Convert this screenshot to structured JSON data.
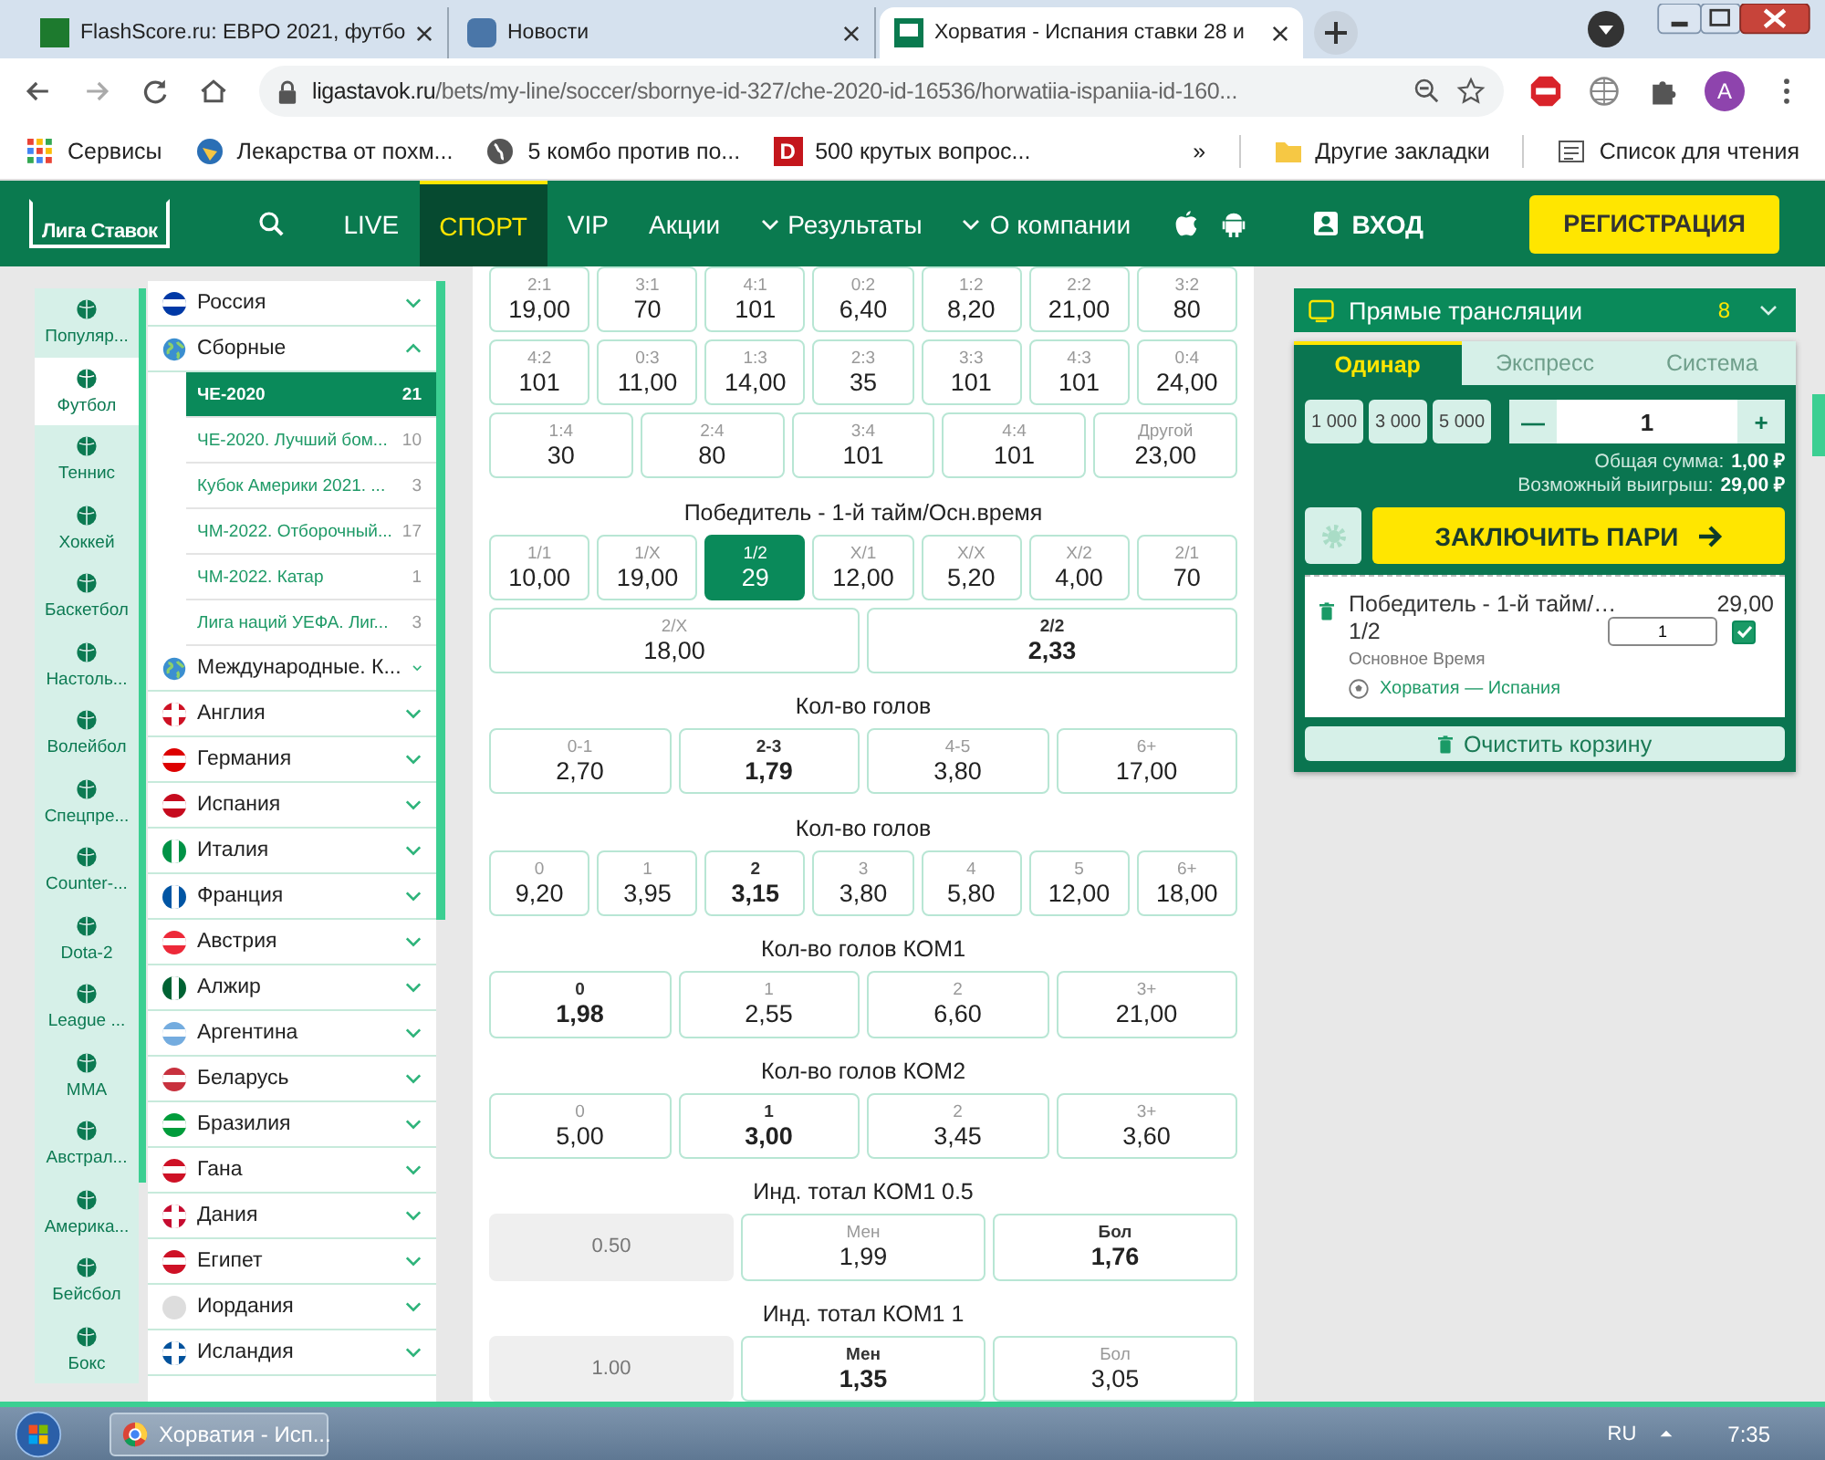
{
  "browser": {
    "tabs": [
      {
        "title": "FlashScore.ru: ЕВРО 2021, футбо",
        "kind": "score",
        "selected": false
      },
      {
        "title": "Новости",
        "kind": "vk",
        "selected": false
      },
      {
        "title": "Хорватия - Испания ставки 28 и",
        "kind": "liga",
        "selected": true
      }
    ],
    "address": {
      "host": "ligastavok.ru",
      "path": "/bets/my-line/soccer/sbornye-id-327/che-2020-id-16536/horwatiia-ispaniia-id-160..."
    },
    "profile": "A",
    "bookmarks": [
      {
        "kind": "apps",
        "label": "Сервисы"
      },
      {
        "kind": "site",
        "label": "Лекарства от похм..."
      },
      {
        "kind": "globe",
        "label": "5 комбо против по..."
      },
      {
        "kind": "letter",
        "letter": "D",
        "label": "500 крутых вопрос..."
      }
    ],
    "bookmarks_more": "»",
    "other_bookmarks": "Другие закладки",
    "reading_list": "Список для чтения"
  },
  "site": {
    "logo": "Лига Ставок",
    "nav": [
      {
        "label": "LIVE",
        "selected": false,
        "dropdown": false
      },
      {
        "label": "СПОРТ",
        "selected": true,
        "dropdown": false
      },
      {
        "label": "VIP",
        "selected": false,
        "dropdown": false
      },
      {
        "label": "Акции",
        "selected": false,
        "dropdown": false
      },
      {
        "label": "Результаты",
        "selected": false,
        "dropdown": true
      },
      {
        "label": "О компании",
        "selected": false,
        "dropdown": true
      }
    ],
    "login": "ВХОД",
    "register": "РЕГИСТРАЦИЯ"
  },
  "sports": [
    {
      "label": "Популяр...",
      "selected": false
    },
    {
      "label": "Футбол",
      "selected": true
    },
    {
      "label": "Теннис",
      "selected": false
    },
    {
      "label": "Хоккей",
      "selected": false
    },
    {
      "label": "Баскетбол",
      "selected": false
    },
    {
      "label": "Настоль...",
      "selected": false
    },
    {
      "label": "Волейбол",
      "selected": false
    },
    {
      "label": "Спецпре...",
      "selected": false
    },
    {
      "label": "Counter-...",
      "selected": false
    },
    {
      "label": "Dota-2",
      "selected": false
    },
    {
      "label": "League ...",
      "selected": false
    },
    {
      "label": "MMA",
      "selected": false
    },
    {
      "label": "Австрал...",
      "selected": false
    },
    {
      "label": "Америка...",
      "selected": false
    },
    {
      "label": "Бейсбол",
      "selected": false
    },
    {
      "label": "Бокс",
      "selected": false
    }
  ],
  "countries": [
    {
      "label": "Россия",
      "kind": "hflag",
      "color": "#0039a6",
      "expanded": false
    },
    {
      "label": "Сборные",
      "kind": "globe",
      "expanded": true,
      "children": [
        {
          "label": "ЧЕ-2020",
          "count": "21",
          "selected": true
        },
        {
          "label": "ЧЕ-2020. Лучший бом...",
          "count": "10",
          "selected": false
        },
        {
          "label": "Кубок Америки 2021. ...",
          "count": "3",
          "selected": false
        },
        {
          "label": "ЧМ-2022. Отборочный...",
          "count": "17",
          "selected": false
        },
        {
          "label": "ЧМ-2022. Катар",
          "count": "1",
          "selected": false
        },
        {
          "label": "Лига наций УЕФА. Лиг...",
          "count": "3",
          "selected": false
        }
      ]
    },
    {
      "label": "Международные. К...",
      "kind": "globe",
      "expanded": false
    },
    {
      "label": "Англия",
      "kind": "cross",
      "color": "#ce1124",
      "expanded": false
    },
    {
      "label": "Германия",
      "kind": "hflag",
      "color": "#dd0000",
      "expanded": false
    },
    {
      "label": "Испания",
      "kind": "hflag",
      "color": "#c60b1e",
      "expanded": false
    },
    {
      "label": "Италия",
      "kind": "vflag",
      "color": "#009246",
      "expanded": false
    },
    {
      "label": "Франция",
      "kind": "vflag",
      "color": "#0055a4",
      "expanded": false
    },
    {
      "label": "Австрия",
      "kind": "hflag",
      "color": "#ed2939",
      "expanded": false
    },
    {
      "label": "Алжир",
      "kind": "vflag",
      "color": "#006233",
      "expanded": false
    },
    {
      "label": "Аргентина",
      "kind": "hflag",
      "color": "#74acdf",
      "expanded": false
    },
    {
      "label": "Беларусь",
      "kind": "hflag",
      "color": "#c8313e",
      "expanded": false
    },
    {
      "label": "Бразилия",
      "kind": "hflag",
      "color": "#009c3b",
      "expanded": false
    },
    {
      "label": "Гана",
      "kind": "hflag",
      "color": "#ce1126",
      "expanded": false
    },
    {
      "label": "Дания",
      "kind": "cross",
      "color": "#c60c30",
      "expanded": false
    },
    {
      "label": "Египет",
      "kind": "hflag",
      "color": "#ce1126",
      "expanded": false
    },
    {
      "label": "Иордания",
      "kind": "blank",
      "color": "#dddddd",
      "expanded": false
    },
    {
      "label": "Исландия",
      "kind": "cross",
      "color": "#02529c",
      "expanded": false
    }
  ],
  "markets": [
    {
      "lines": [
        {
          "outcomes": [
            {
              "kind": "odds",
              "label": "2:1",
              "odds": "19,00",
              "selected": false,
              "highlighted": false
            },
            {
              "kind": "odds",
              "label": "3:1",
              "odds": "70",
              "selected": false,
              "highlighted": false
            },
            {
              "kind": "odds",
              "label": "4:1",
              "odds": "101",
              "selected": false,
              "highlighted": false
            },
            {
              "kind": "odds",
              "label": "0:2",
              "odds": "6,40",
              "selected": false,
              "highlighted": false
            },
            {
              "kind": "odds",
              "label": "1:2",
              "odds": "8,20",
              "selected": false,
              "highlighted": false
            },
            {
              "kind": "odds",
              "label": "2:2",
              "odds": "21,00",
              "selected": false,
              "highlighted": false
            },
            {
              "kind": "odds",
              "label": "3:2",
              "odds": "80",
              "selected": false,
              "highlighted": false
            }
          ]
        },
        {
          "outcomes": [
            {
              "kind": "odds",
              "label": "4:2",
              "odds": "101",
              "selected": false,
              "highlighted": false
            },
            {
              "kind": "odds",
              "label": "0:3",
              "odds": "11,00",
              "selected": false,
              "highlighted": false
            },
            {
              "kind": "odds",
              "label": "1:3",
              "odds": "14,00",
              "selected": false,
              "highlighted": false
            },
            {
              "kind": "odds",
              "label": "2:3",
              "odds": "35",
              "selected": false,
              "highlighted": false
            },
            {
              "kind": "odds",
              "label": "3:3",
              "odds": "101",
              "selected": false,
              "highlighted": false
            },
            {
              "kind": "odds",
              "label": "4:3",
              "odds": "101",
              "selected": false,
              "highlighted": false
            },
            {
              "kind": "odds",
              "label": "0:4",
              "odds": "24,00",
              "selected": false,
              "highlighted": false
            }
          ]
        },
        {
          "outcomes": [
            {
              "kind": "odds",
              "label": "1:4",
              "odds": "30",
              "selected": false,
              "highlighted": false
            },
            {
              "kind": "odds",
              "label": "2:4",
              "odds": "80",
              "selected": false,
              "highlighted": false
            },
            {
              "kind": "odds",
              "label": "3:4",
              "odds": "101",
              "selected": false,
              "highlighted": false
            },
            {
              "kind": "odds",
              "label": "4:4",
              "odds": "101",
              "selected": false,
              "highlighted": false
            },
            {
              "kind": "odds",
              "label": "Другой",
              "odds": "23,00",
              "selected": false,
              "highlighted": false
            }
          ]
        }
      ]
    },
    {
      "title": "Победитель - 1-й тайм/Осн.время",
      "lines": [
        {
          "outcomes": [
            {
              "kind": "odds",
              "label": "1/1",
              "odds": "10,00",
              "selected": false,
              "highlighted": false
            },
            {
              "kind": "odds",
              "label": "1/X",
              "odds": "19,00",
              "selected": false,
              "highlighted": false
            },
            {
              "kind": "odds",
              "label": "1/2",
              "odds": "29",
              "selected": true,
              "highlighted": false
            },
            {
              "kind": "odds",
              "label": "X/1",
              "odds": "12,00",
              "selected": false,
              "highlighted": false
            },
            {
              "kind": "odds",
              "label": "X/X",
              "odds": "5,20",
              "selected": false,
              "highlighted": false
            },
            {
              "kind": "odds",
              "label": "X/2",
              "odds": "4,00",
              "selected": false,
              "highlighted": false
            },
            {
              "kind": "odds",
              "label": "2/1",
              "odds": "70",
              "selected": false,
              "highlighted": false
            }
          ]
        },
        {
          "outcomes": [
            {
              "kind": "odds",
              "label": "2/X",
              "odds": "18,00",
              "selected": false,
              "highlighted": false
            },
            {
              "kind": "odds",
              "label": "2/2",
              "odds": "2,33",
              "selected": false,
              "highlighted": true
            }
          ]
        }
      ]
    },
    {
      "title": "Кол-во голов",
      "lines": [
        {
          "outcomes": [
            {
              "kind": "odds",
              "label": "0-1",
              "odds": "2,70",
              "selected": false,
              "highlighted": false
            },
            {
              "kind": "odds",
              "label": "2-3",
              "odds": "1,79",
              "selected": false,
              "highlighted": true
            },
            {
              "kind": "odds",
              "label": "4-5",
              "odds": "3,80",
              "selected": false,
              "highlighted": false
            },
            {
              "kind": "odds",
              "label": "6+",
              "odds": "17,00",
              "selected": false,
              "highlighted": false
            }
          ]
        }
      ]
    },
    {
      "title": "Кол-во голов",
      "lines": [
        {
          "outcomes": [
            {
              "kind": "odds",
              "label": "0",
              "odds": "9,20",
              "selected": false,
              "highlighted": false
            },
            {
              "kind": "odds",
              "label": "1",
              "odds": "3,95",
              "selected": false,
              "highlighted": false
            },
            {
              "kind": "odds",
              "label": "2",
              "odds": "3,15",
              "selected": false,
              "highlighted": true
            },
            {
              "kind": "odds",
              "label": "3",
              "odds": "3,80",
              "selected": false,
              "highlighted": false
            },
            {
              "kind": "odds",
              "label": "4",
              "odds": "5,80",
              "selected": false,
              "highlighted": false
            },
            {
              "kind": "odds",
              "label": "5",
              "odds": "12,00",
              "selected": false,
              "highlighted": false
            },
            {
              "kind": "odds",
              "label": "6+",
              "odds": "18,00",
              "selected": false,
              "highlighted": false
            }
          ]
        }
      ]
    },
    {
      "title": "Кол-во голов КОМ1",
      "lines": [
        {
          "outcomes": [
            {
              "kind": "odds",
              "label": "0",
              "odds": "1,98",
              "selected": false,
              "highlighted": true
            },
            {
              "kind": "odds",
              "label": "1",
              "odds": "2,55",
              "selected": false,
              "highlighted": false
            },
            {
              "kind": "odds",
              "label": "2",
              "odds": "6,60",
              "selected": false,
              "highlighted": false
            },
            {
              "kind": "odds",
              "label": "3+",
              "odds": "21,00",
              "selected": false,
              "highlighted": false
            }
          ]
        }
      ]
    },
    {
      "title": "Кол-во голов КОМ2",
      "lines": [
        {
          "outcomes": [
            {
              "kind": "odds",
              "label": "0",
              "odds": "5,00",
              "selected": false,
              "highlighted": false
            },
            {
              "kind": "odds",
              "label": "1",
              "odds": "3,00",
              "selected": false,
              "highlighted": true
            },
            {
              "kind": "odds",
              "label": "2",
              "odds": "3,45",
              "selected": false,
              "highlighted": false
            },
            {
              "kind": "odds",
              "label": "3+",
              "odds": "3,60",
              "selected": false,
              "highlighted": false
            }
          ]
        }
      ]
    },
    {
      "title": "Инд. тотал КОМ1 0.5",
      "lines": [
        {
          "outcomes": [
            {
              "kind": "line",
              "label": "0.50"
            },
            {
              "kind": "odds",
              "label": "Мен",
              "odds": "1,99",
              "selected": false,
              "highlighted": false
            },
            {
              "kind": "odds",
              "label": "Бол",
              "odds": "1,76",
              "selected": false,
              "highlighted": true
            }
          ]
        }
      ]
    },
    {
      "title": "Инд. тотал КОМ1 1",
      "lines": [
        {
          "outcomes": [
            {
              "kind": "line",
              "label": "1.00"
            },
            {
              "kind": "odds",
              "label": "Мен",
              "odds": "1,35",
              "selected": false,
              "highlighted": true
            },
            {
              "kind": "odds",
              "label": "Бол",
              "odds": "3,05",
              "selected": false,
              "highlighted": false
            }
          ]
        }
      ]
    }
  ],
  "live": {
    "title": "Прямые трансляции",
    "count": "8"
  },
  "betslip": {
    "tabs": [
      {
        "label": "Одинар",
        "selected": true
      },
      {
        "label": "Экспресс",
        "selected": false
      },
      {
        "label": "Система",
        "selected": false
      }
    ],
    "amounts": [
      "1 000",
      "3 000",
      "5 000"
    ],
    "minus": "—",
    "stake": "1",
    "plus": "+",
    "total_label": "Общая сумма:",
    "total": "1,00 ₽",
    "win_label": "Возможный выигрыш:",
    "win": "29,00 ₽",
    "submit": "ЗАКЛЮЧИТЬ ПАРИ",
    "bet": {
      "market": "Победитель - 1-й тайм/…",
      "odds": "29,00",
      "pick": "1/2",
      "stake": "1",
      "checked": true,
      "period": "Основное Время",
      "match": "Хорватия — Испания"
    },
    "clear": "Очистить корзину"
  },
  "taskbar": {
    "app": "Хорватия - Исп...",
    "lang": "RU",
    "time": "7:35"
  }
}
